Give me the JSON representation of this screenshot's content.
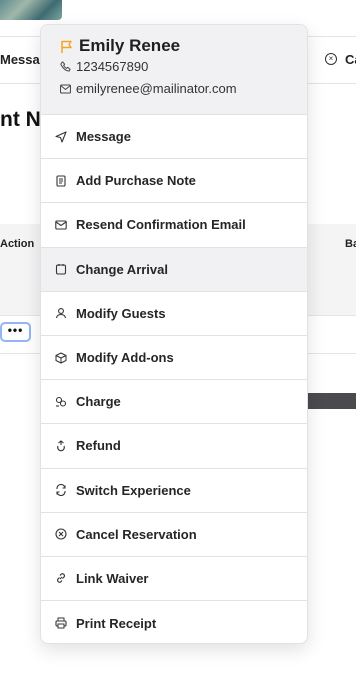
{
  "background": {
    "toolbar_message_label": "Messa",
    "toolbar_cancel_label": "Ca",
    "heading_fragment": "nt No",
    "table_action_header": "Action",
    "table_ba_header": "Ba",
    "row_actions_button": "•••"
  },
  "menu": {
    "guest_name": "Emily Renee",
    "phone": "1234567890",
    "email": "emilyrenee@mailinator.com",
    "flag_color": "#f5a524",
    "items": [
      {
        "label": "Message",
        "icon": "send-icon"
      },
      {
        "label": "Add Purchase Note",
        "icon": "note-icon"
      },
      {
        "label": "Resend Confirmation Email",
        "icon": "mail-icon"
      },
      {
        "label": "Change Arrival",
        "icon": "calendar-icon"
      },
      {
        "label": "Modify Guests",
        "icon": "user-icon"
      },
      {
        "label": "Modify Add-ons",
        "icon": "box-icon"
      },
      {
        "label": "Charge",
        "icon": "coins-icon"
      },
      {
        "label": "Refund",
        "icon": "refund-icon"
      },
      {
        "label": "Switch Experience",
        "icon": "switch-icon"
      },
      {
        "label": "Cancel Reservation",
        "icon": "cancel-circle-icon"
      },
      {
        "label": "Link Waiver",
        "icon": "link-icon"
      },
      {
        "label": "Print Receipt",
        "icon": "printer-icon"
      }
    ],
    "active_item": "Change Arrival"
  }
}
